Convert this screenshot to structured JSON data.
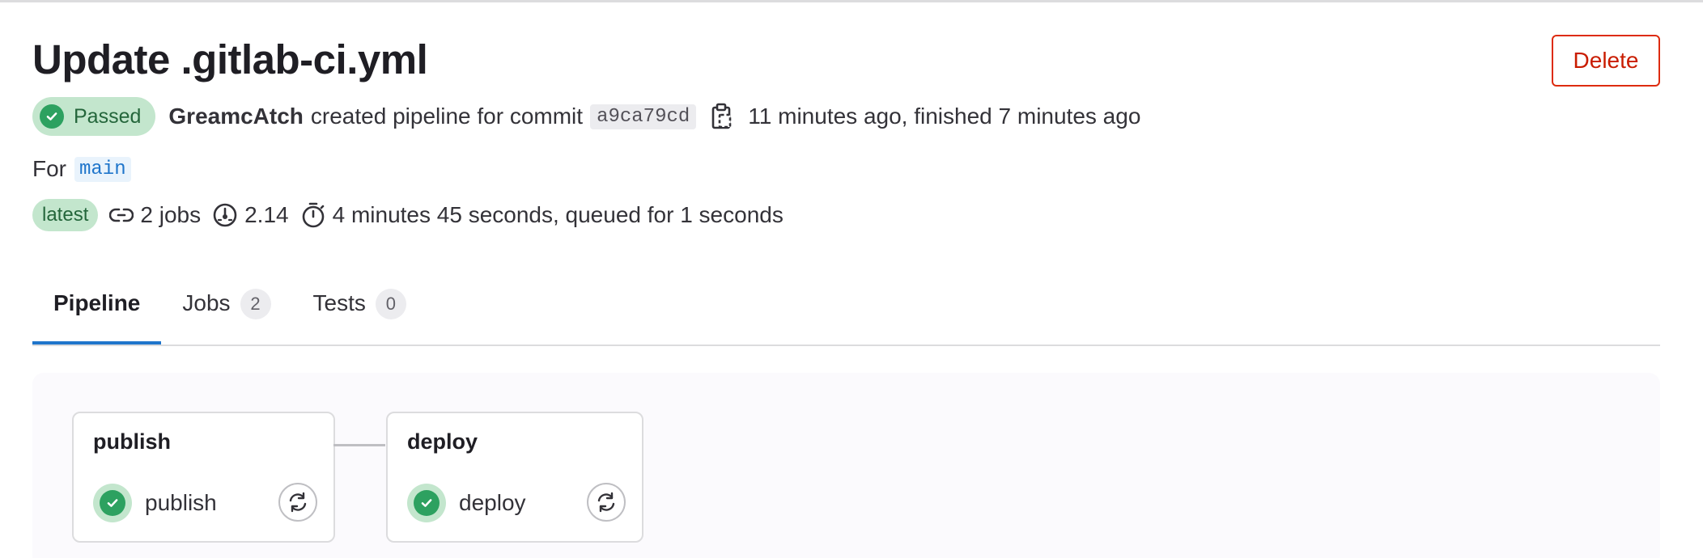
{
  "header": {
    "title": "Update .gitlab-ci.yml",
    "delete_label": "Delete"
  },
  "meta": {
    "status": "Passed",
    "author": "GreamcAtch",
    "action_text": "created pipeline for commit",
    "commit_sha": "a9ca79cd",
    "timing_text": "11 minutes ago, finished 7 minutes ago"
  },
  "ref": {
    "prefix": "For",
    "branch": "main"
  },
  "stats": {
    "latest_badge": "latest",
    "jobs_text": "2 jobs",
    "compute": "2.14",
    "duration_text": "4 minutes 45 seconds, queued for 1 seconds"
  },
  "tabs": [
    {
      "label": "Pipeline",
      "count": null,
      "active": true
    },
    {
      "label": "Jobs",
      "count": "2",
      "active": false
    },
    {
      "label": "Tests",
      "count": "0",
      "active": false
    }
  ],
  "stages": [
    {
      "name": "publish",
      "jobs": [
        {
          "name": "publish",
          "status": "passed"
        }
      ]
    },
    {
      "name": "deploy",
      "jobs": [
        {
          "name": "deploy",
          "status": "passed"
        }
      ]
    }
  ],
  "colors": {
    "success": "#2da160",
    "success_bg": "#c3e6cd",
    "danger": "#dd2b0e",
    "link": "#1f75cb"
  },
  "icons": {
    "status": "check-circle-icon",
    "copy": "copy-to-clipboard-icon",
    "jobs": "pipeline-link-icon",
    "compute": "dashboard-gauge-icon",
    "duration": "stopwatch-icon",
    "retry": "retry-icon"
  }
}
